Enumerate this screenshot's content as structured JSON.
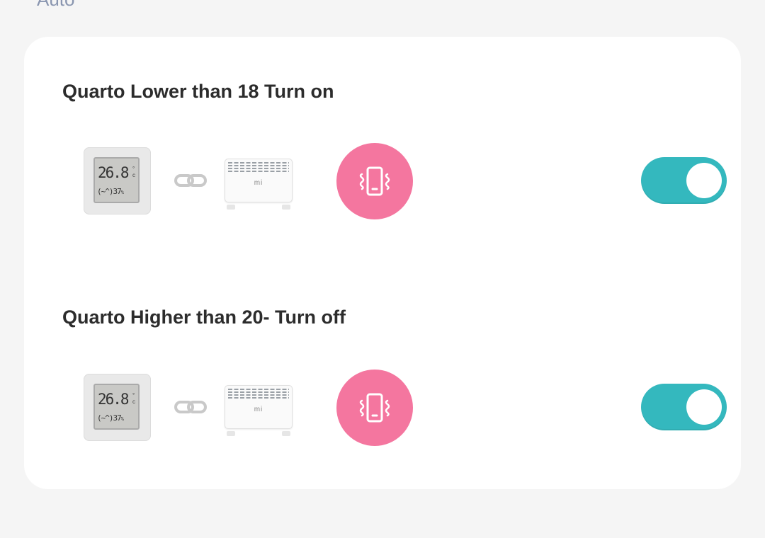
{
  "section": {
    "label": "Auto"
  },
  "rules": [
    {
      "title": "Quarto Lower than 18 Turn on",
      "sensor": {
        "temp": "26.8",
        "unit_top": "°",
        "unit_bottom": "c",
        "bottom_line": "(~^)37",
        "humidity_unit": "%"
      },
      "device": {
        "logo": "mi"
      },
      "action_icon": "vibrate-icon",
      "enabled": true
    },
    {
      "title": "Quarto Higher than 20- Turn off",
      "sensor": {
        "temp": "26.8",
        "unit_top": "°",
        "unit_bottom": "c",
        "bottom_line": "(~^)37",
        "humidity_unit": "%"
      },
      "device": {
        "logo": "mi"
      },
      "action_icon": "vibrate-icon",
      "enabled": true
    }
  ],
  "colors": {
    "toggle_on": "#34b8be",
    "action_circle": "#f4769f",
    "section_label": "#8a96b0"
  }
}
